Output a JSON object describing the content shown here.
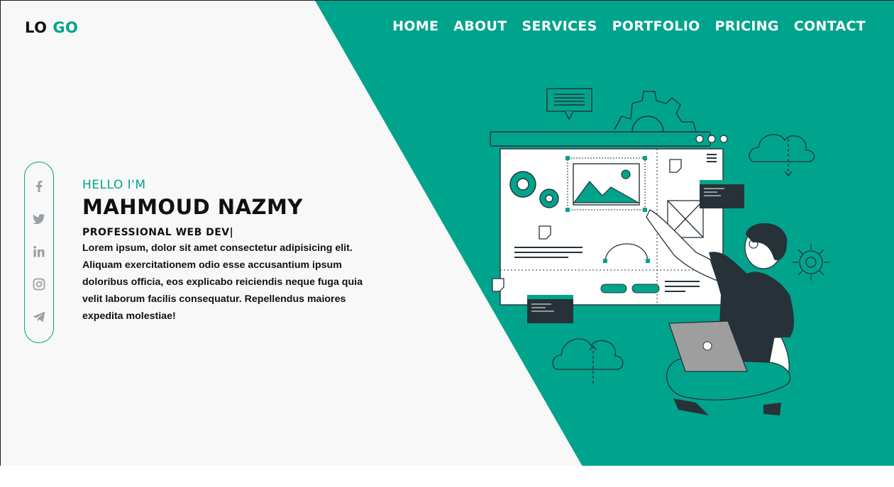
{
  "brand": {
    "logo_part1": "LO",
    "logo_part2": "GO"
  },
  "nav": {
    "items": [
      {
        "label": "HOME"
      },
      {
        "label": "ABOUT"
      },
      {
        "label": "SERVICES"
      },
      {
        "label": "PORTFOLIO"
      },
      {
        "label": "PRICING"
      },
      {
        "label": "CONTACT"
      }
    ]
  },
  "social": {
    "icons": [
      "facebook-icon",
      "twitter-icon",
      "linkedin-icon",
      "instagram-icon",
      "telegram-icon"
    ]
  },
  "intro": {
    "greeting": "HELLO I'M",
    "name": "MAHMOUD NAZMY",
    "role": "PROFESSIONAL WEB DEV|",
    "description": "Lorem ipsum, dolor sit amet consectetur adipisicing elit. Aliquam exercitationem odio esse accusantium ipsum doloribus officia, eos explicabo reiciendis neque fuga quia velit laborum facilis consequatur. Repellendus maiores expedita molestiae!"
  },
  "colors": {
    "accent": "#00a48c",
    "background": "#f8f8f8",
    "dark": "#263238",
    "icon_gray": "#9aa0a6"
  }
}
